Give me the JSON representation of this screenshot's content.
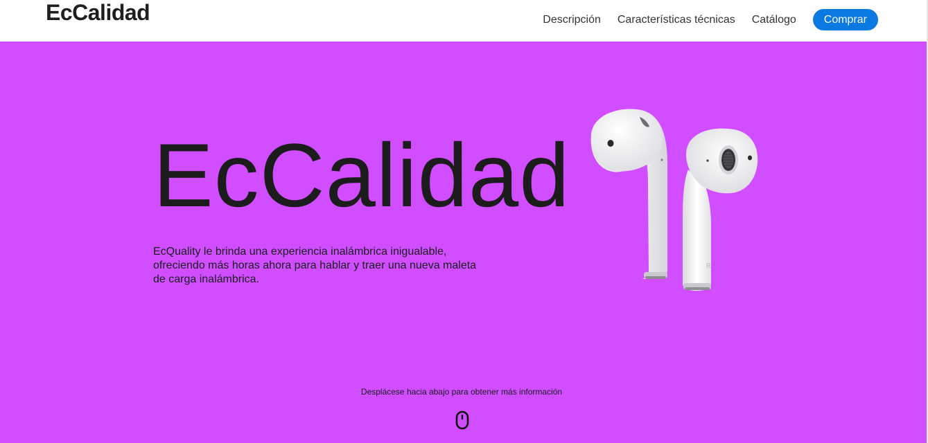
{
  "header": {
    "logo": "EcCalidad",
    "nav": [
      {
        "label": "Descripción"
      },
      {
        "label": "Características técnicas"
      },
      {
        "label": "Catálogo"
      }
    ],
    "buy_label": "Comprar"
  },
  "hero": {
    "title": "EcCalidad",
    "description": "EcQuality le brinda una experiencia inalámbrica inigualable, ofreciendo más horas ahora para hablar y traer una nueva maleta de carga inalámbrica.",
    "image_icon": "earbuds-image",
    "scroll_hint": "Desplácese hacia abajo para obtener más información",
    "scroll_icon": "mouse-icon"
  },
  "colors": {
    "hero_background": "#d04eff",
    "buy_button": "#0a7ae2",
    "header_background": "#ffffff",
    "text": "#1c1c1c"
  }
}
